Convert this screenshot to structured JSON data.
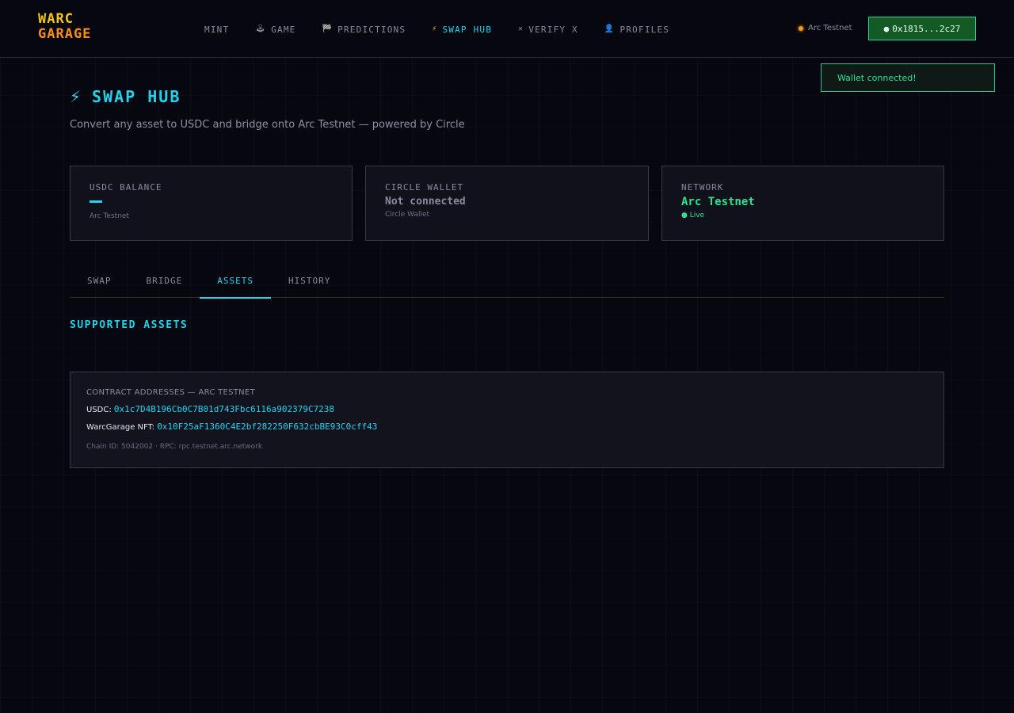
{
  "header": {
    "logo_line1": "WARC",
    "logo_line2": "GARAGE",
    "nav": [
      {
        "icon": "",
        "label": "MINT"
      },
      {
        "icon": "🕹",
        "label": "GAME"
      },
      {
        "icon": "🏁",
        "label": "PREDICTIONS"
      },
      {
        "icon": "⚡",
        "label": "SWAP HUB"
      },
      {
        "icon": "✕",
        "label": "VERIFY X"
      },
      {
        "icon": "👤",
        "label": "PROFILES"
      }
    ],
    "network_label": "Arc Testnet",
    "wallet_button": "0x1815...2c27"
  },
  "toast": {
    "message": "Wallet connected!"
  },
  "page": {
    "title": "SWAP HUB",
    "subtitle": "Convert any asset to USDC and bridge onto Arc Testnet — powered by Circle"
  },
  "cards": [
    {
      "label": "USDC BALANCE",
      "value": "—",
      "sub": "Arc Testnet"
    },
    {
      "label": "CIRCLE WALLET",
      "value": "Not connected",
      "sub": "Circle Wallet"
    },
    {
      "label": "NETWORK",
      "value": "Arc Testnet",
      "sub": "● Live"
    }
  ],
  "tabs": [
    "SWAP",
    "BRIDGE",
    "ASSETS",
    "HISTORY"
  ],
  "section_title": "SUPPORTED ASSETS",
  "contracts": {
    "heading": "CONTRACT ADDRESSES — ARC TESTNET",
    "usdc_label": "USDC:",
    "usdc_address": "0x1c7D4B196Cb0C7B01d743Fbc6116a902379C7238",
    "nft_label": "WarcGarage NFT:",
    "nft_address": "0x10F25aF1360C4E2bf282250F632cbBE93C0cff43",
    "footer": "Chain ID: 5042002 · RPC: rpc.testnet.arc.network"
  },
  "colors": {
    "accent": "#22d3ee",
    "live": "#2ee08f",
    "logo_yellow": "#f5c518",
    "logo_orange": "#ff8c1a"
  }
}
